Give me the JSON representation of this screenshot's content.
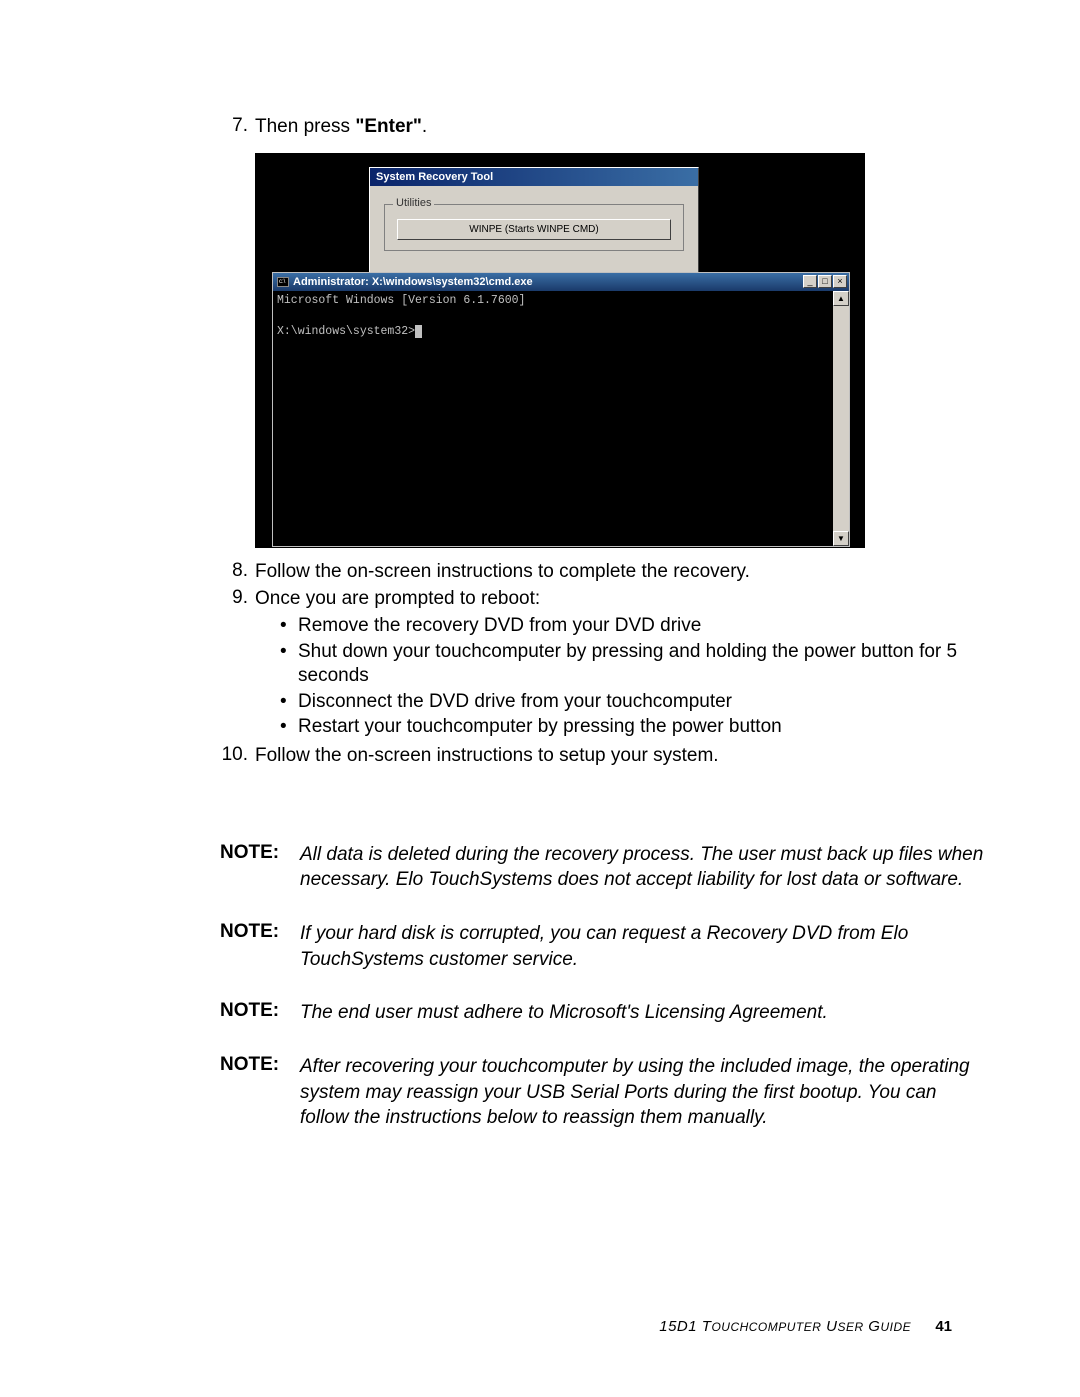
{
  "steps": {
    "s7": {
      "num": "7.",
      "text_a": "Then press ",
      "bold": "\"Enter\"",
      "text_b": "."
    },
    "s8": {
      "num": "8.",
      "text": "Follow the on-screen instructions to complete the recovery."
    },
    "s9": {
      "num": "9.",
      "text": "Once you are prompted to reboot:",
      "bullets": [
        "Remove the recovery DVD from your DVD drive",
        "Shut down your touchcomputer by pressing and holding the power button for 5 seconds",
        "Disconnect the DVD drive from your touchcomputer",
        "Restart your touchcomputer by pressing the power button"
      ]
    },
    "s10": {
      "num": "10.",
      "text": "Follow the on-screen instructions to setup your system."
    }
  },
  "screenshot": {
    "recovery_title": "System Recovery Tool",
    "fieldset_label": "Utilities",
    "winpe_button": "WINPE (Starts WINPE CMD)",
    "cmd_title": "Administrator: X:\\windows\\system32\\cmd.exe",
    "cmd_line1": "Microsoft Windows [Version 6.1.7600]",
    "cmd_line2": "X:\\windows\\system32>",
    "min": "_",
    "max": "□",
    "close": "×",
    "up": "▲",
    "down": "▼"
  },
  "notes": [
    {
      "label": "NOTE:",
      "body": "All data is deleted during the recovery process. The user must back up files when necessary. Elo TouchSystems does not accept liability for lost data or software."
    },
    {
      "label": "NOTE:",
      "body": "If your hard disk is corrupted, you can request a Recovery DVD from Elo TouchSystems customer service."
    },
    {
      "label": "NOTE:",
      "body": "The end user must adhere to Microsoft's Licensing Agreement."
    },
    {
      "label": "NOTE:",
      "body": "After recovering your touchcomputer by using the included image, the operating system may reassign your USB Serial Ports during the first bootup. You can follow the instructions below to reassign them manually."
    }
  ],
  "footer": {
    "model": "15D1 T",
    "rest": "OUCHCOMPUTER",
    "rest2": " U",
    "rest3": "SER",
    "rest4": " G",
    "rest5": "UIDE",
    "page": "41"
  }
}
